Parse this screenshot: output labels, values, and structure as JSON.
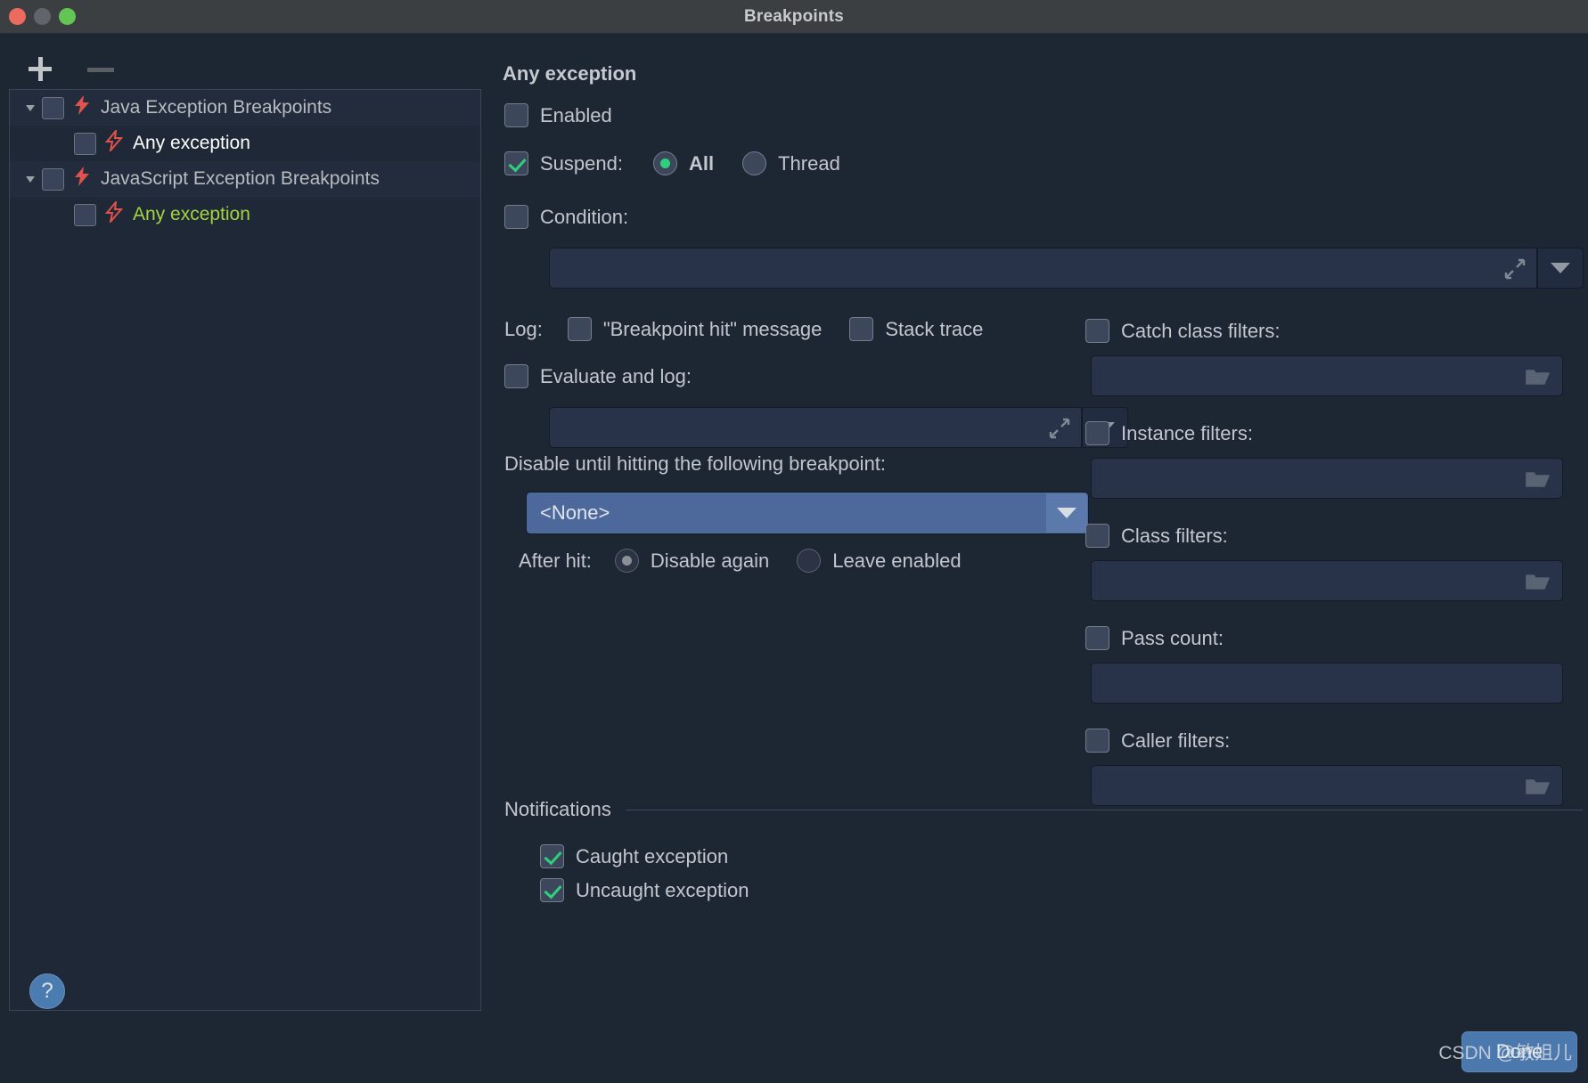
{
  "window": {
    "title": "Breakpoints",
    "traffic_lights": [
      "close-red",
      "minimize-yellow",
      "maximize-green"
    ]
  },
  "sidebar": {
    "toolbar": {
      "add_label": "+",
      "remove_label": "−"
    },
    "tree": [
      {
        "label": "Java Exception Breakpoints",
        "type": "group",
        "expanded": true,
        "checked": false,
        "selected": false,
        "color": "default"
      },
      {
        "label": "Any exception",
        "type": "child",
        "checked": false,
        "selected": true,
        "color": "default"
      },
      {
        "label": "JavaScript Exception Breakpoints",
        "type": "group",
        "expanded": true,
        "checked": false,
        "selected": false,
        "color": "default"
      },
      {
        "label": "Any exception",
        "type": "child",
        "checked": false,
        "selected": false,
        "color": "green"
      }
    ],
    "help_label": "?"
  },
  "details": {
    "title": "Any exception",
    "enabled": {
      "label": "Enabled",
      "checked": false
    },
    "suspend": {
      "label": "Suspend:",
      "checked": true,
      "options": [
        {
          "label": "All",
          "selected": true
        },
        {
          "label": "Thread",
          "selected": false
        }
      ]
    },
    "condition": {
      "label": "Condition:",
      "checked": false,
      "value": "",
      "expand_icon": "expand-icon",
      "dropdown_icon": "chevron-down-icon"
    },
    "log": {
      "label": "Log:",
      "breakpoint_hit": {
        "label": "\"Breakpoint hit\" message",
        "checked": false
      },
      "stack_trace": {
        "label": "Stack trace",
        "checked": false
      },
      "evaluate_and_log": {
        "label": "Evaluate and log:",
        "checked": false,
        "value": ""
      }
    },
    "disable_until": {
      "label": "Disable until hitting the following breakpoint:",
      "selected_value": "<None>",
      "after_hit_label": "After hit:",
      "after_hit_options": [
        {
          "label": "Disable again",
          "selected": true
        },
        {
          "label": "Leave enabled",
          "selected": false
        }
      ]
    },
    "filters": [
      {
        "label": "Catch class filters:",
        "checked": false,
        "value": "",
        "has_browse": true
      },
      {
        "label": "Instance filters:",
        "checked": false,
        "value": "",
        "has_browse": true
      },
      {
        "label": "Class filters:",
        "checked": false,
        "value": "",
        "has_browse": true
      },
      {
        "label": "Pass count:",
        "checked": false,
        "value": "",
        "has_browse": false
      },
      {
        "label": "Caller filters:",
        "checked": false,
        "value": "",
        "has_browse": true
      }
    ],
    "notifications": {
      "title": "Notifications",
      "items": [
        {
          "label": "Caught exception",
          "checked": true
        },
        {
          "label": "Uncaught exception",
          "checked": true
        }
      ]
    }
  },
  "footer": {
    "done_label": "Done",
    "watermark": "CSDN @敏姐儿"
  },
  "colors": {
    "background": "#1d2633",
    "titlebar": "#3c3f41",
    "selection": "#3c4a77",
    "accent_green": "#2fd07c",
    "bolt_red": "#e0524a",
    "green_text": "#a5d340",
    "combo_blue": "#4d699c"
  }
}
